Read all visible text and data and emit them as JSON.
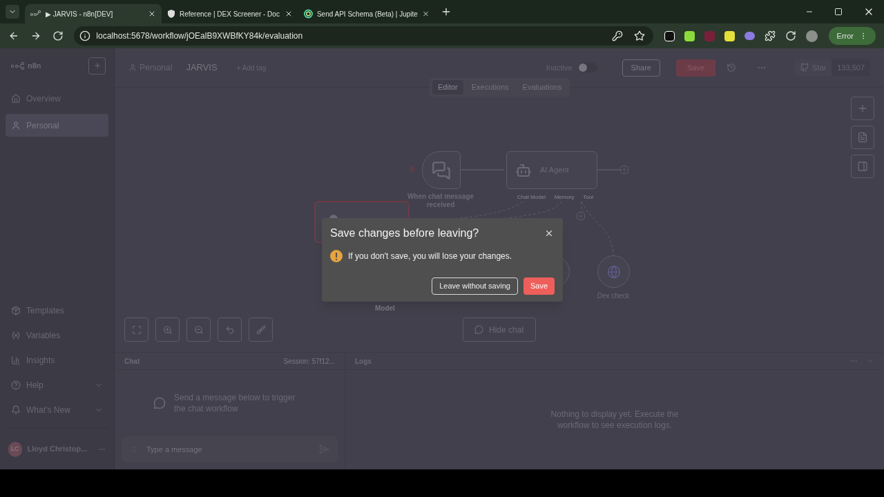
{
  "browser": {
    "tabs": [
      {
        "title": "▶ JARVIS - n8n[DEV]",
        "selected": true
      },
      {
        "title": "Reference | DEX Screener - Doc",
        "selected": false
      },
      {
        "title": "Send API Schema (Beta) | Jupite",
        "selected": false
      }
    ],
    "url": "localhost:5678/workflow/jOEalB9XWBfKY84k/evaluation",
    "profile_button": "Error"
  },
  "sidebar": {
    "logo": "n8n",
    "top_items": [
      {
        "label": "Overview",
        "selected": false
      },
      {
        "label": "Personal",
        "selected": true
      }
    ],
    "bottom_items": [
      {
        "label": "Templates",
        "expandable": false
      },
      {
        "label": "Variables",
        "expandable": false
      },
      {
        "label": "Insights",
        "expandable": false
      },
      {
        "label": "Help",
        "expandable": true
      },
      {
        "label": "What’s New",
        "expandable": true
      }
    ],
    "user": {
      "initials": "LC",
      "name": "Lloyd Christop..."
    }
  },
  "header": {
    "project": "Personal",
    "workflow": "JARVIS",
    "add_tag": "+ Add tag",
    "active_label": "Inactive",
    "active": false,
    "share": "Share",
    "save": "Save",
    "star": "Star",
    "star_count": "133,507"
  },
  "view_tabs": [
    {
      "label": "Editor",
      "selected": true
    },
    {
      "label": "Executions",
      "selected": false
    },
    {
      "label": "Evaluations",
      "selected": false
    }
  ],
  "nodes": [
    {
      "kind": "trigger",
      "label": "When chat message received"
    },
    {
      "kind": "agent",
      "label": "AI Agent",
      "handles": [
        "Chat Model",
        "Memory",
        "Tool"
      ]
    },
    {
      "kind": "box",
      "error": true
    },
    {
      "kind": "caption",
      "label": "Model"
    },
    {
      "kind": "circle"
    },
    {
      "kind": "circle",
      "label": "Dex check"
    }
  ],
  "hide_chat": "Hide chat",
  "chat": {
    "title": "Chat",
    "session": "Session: 57f12...",
    "empty": "Send a message below to trigger the chat workflow",
    "placeholder": "Type a message"
  },
  "logs": {
    "title": "Logs",
    "empty": "Nothing to display yet. Execute the workflow to see execution logs."
  },
  "dialog": {
    "title": "Save changes before leaving?",
    "message": "If you don't save, you will lose your changes.",
    "buttons": [
      {
        "label": "Leave without saving",
        "primary": false
      },
      {
        "label": "Save",
        "primary": true
      }
    ]
  }
}
